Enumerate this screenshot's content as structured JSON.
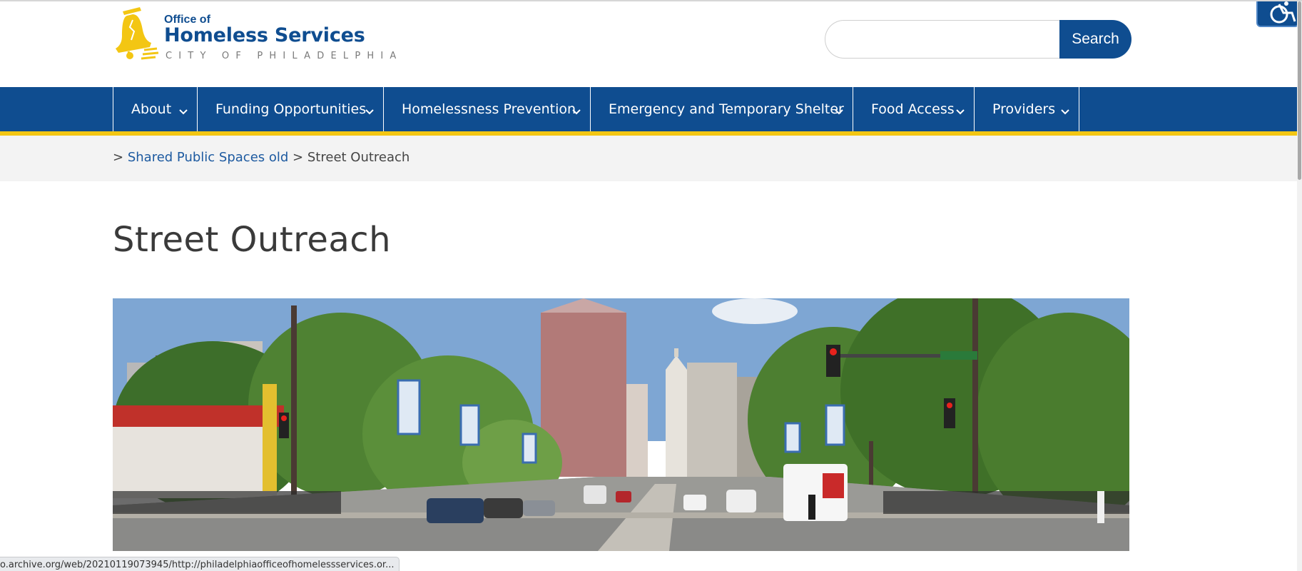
{
  "header": {
    "logo": {
      "small_text": "Office of",
      "large_text": "Homeless Services",
      "city_text": "CITY OF PHILADELPHIA",
      "bell_color": "#f3c613"
    },
    "search": {
      "placeholder": "",
      "value": "",
      "button_label": "Search"
    },
    "accessibility_icon": "wheelchair-icon"
  },
  "nav": {
    "items": [
      {
        "label": "About"
      },
      {
        "label": "Funding Opportunities"
      },
      {
        "label": "Homelessness Prevention"
      },
      {
        "label": "Emergency and Temporary Shelter"
      },
      {
        "label": "Food Access"
      },
      {
        "label": "Providers"
      }
    ]
  },
  "breadcrumb": {
    "separator": ">",
    "parent_label": "Shared Public Spaces old",
    "current_label": "Street Outreach"
  },
  "main": {
    "title": "Street Outreach"
  },
  "status_bar": {
    "url": "o.archive.org/web/20210119073945/http://philadelphiaofficeofhomelessservices.or..."
  },
  "colors": {
    "brand_blue": "#0f4d90",
    "accent_yellow": "#f3c613",
    "breadcrumb_bg": "#f3f3f3"
  }
}
